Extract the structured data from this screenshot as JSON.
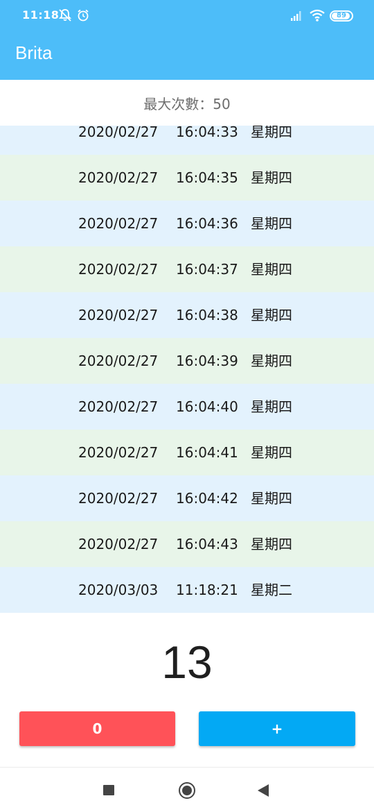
{
  "status_bar": {
    "time": "11:18",
    "battery_level": "89",
    "icons": [
      "mute-alarm-icon",
      "alarm-clock-icon",
      "signal-icon",
      "wifi-icon",
      "battery-icon"
    ]
  },
  "app_bar": {
    "title": "Brita"
  },
  "max_count": {
    "label": "最大次數：50"
  },
  "records": [
    {
      "date": "2020/02/27",
      "time": "16:04:33",
      "weekday": "星期四"
    },
    {
      "date": "2020/02/27",
      "time": "16:04:35",
      "weekday": "星期四"
    },
    {
      "date": "2020/02/27",
      "time": "16:04:36",
      "weekday": "星期四"
    },
    {
      "date": "2020/02/27",
      "time": "16:04:37",
      "weekday": "星期四"
    },
    {
      "date": "2020/02/27",
      "time": "16:04:38",
      "weekday": "星期四"
    },
    {
      "date": "2020/02/27",
      "time": "16:04:39",
      "weekday": "星期四"
    },
    {
      "date": "2020/02/27",
      "time": "16:04:40",
      "weekday": "星期四"
    },
    {
      "date": "2020/02/27",
      "time": "16:04:41",
      "weekday": "星期四"
    },
    {
      "date": "2020/02/27",
      "time": "16:04:42",
      "weekday": "星期四"
    },
    {
      "date": "2020/02/27",
      "time": "16:04:43",
      "weekday": "星期四"
    },
    {
      "date": "2020/03/03",
      "time": "11:18:21",
      "weekday": "星期二"
    }
  ],
  "counter": {
    "value": "13"
  },
  "buttons": {
    "reset_label": "0",
    "plus_label": "+"
  },
  "colors": {
    "header": "#4dbdf9",
    "row_blue": "#e3f2fd",
    "row_green": "#e8f5e9",
    "reset_button": "#ff5258",
    "plus_button": "#03a9f4"
  },
  "nav_bar": {
    "icons": [
      "recent-apps-icon",
      "home-icon",
      "back-icon"
    ]
  }
}
